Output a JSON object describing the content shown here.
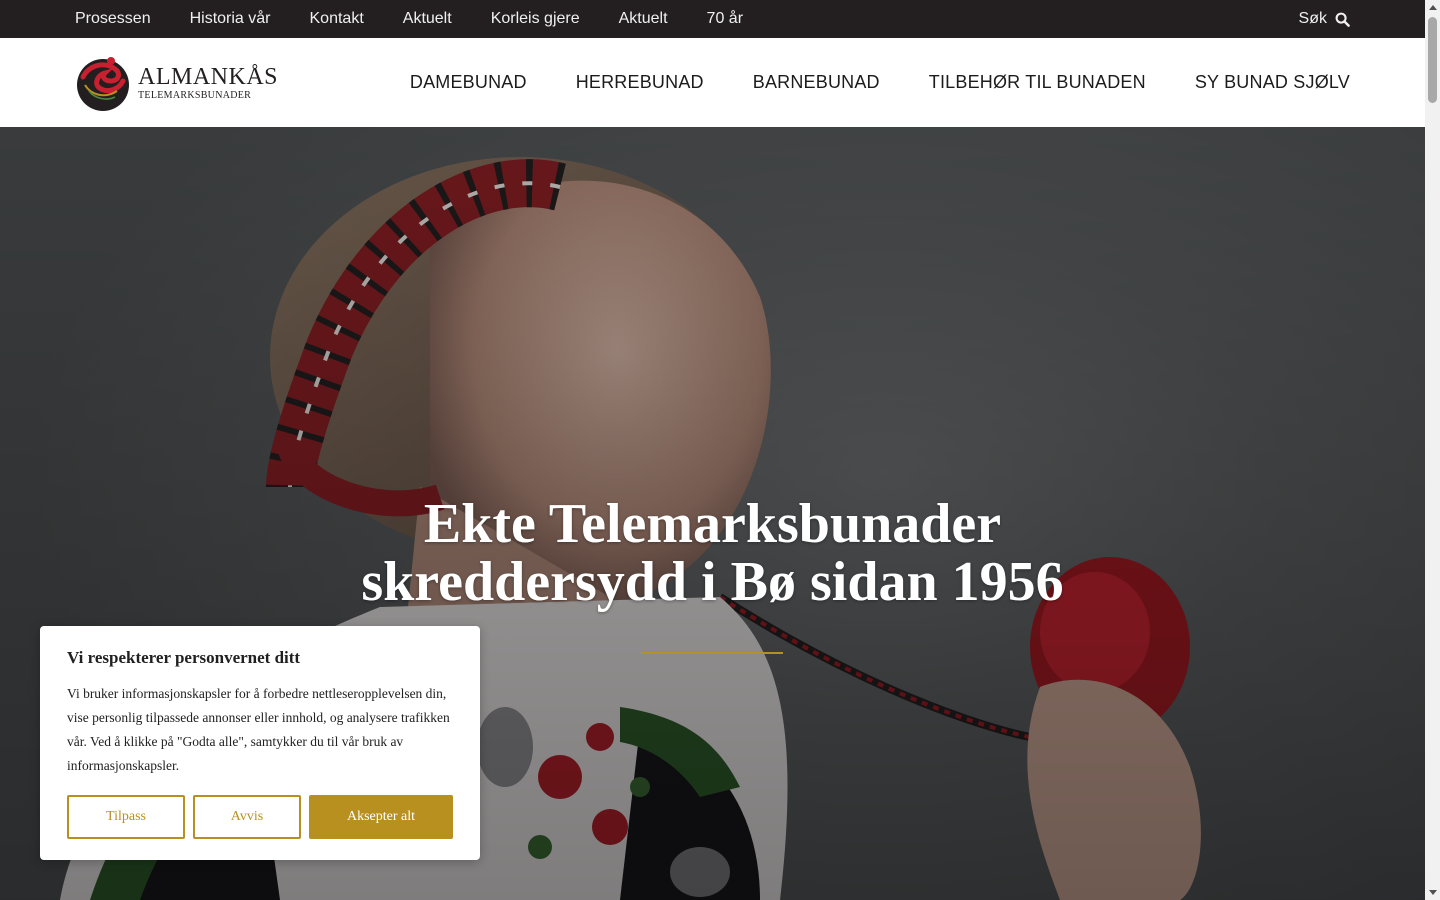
{
  "topbar": {
    "links": [
      "Prosessen",
      "Historia vår",
      "Kontakt",
      "Aktuelt",
      "Korleis gjere",
      "Aktuelt",
      "70 år"
    ],
    "search_label": "Søk"
  },
  "logo": {
    "name": "ALMANKÅS",
    "subtitle": "TELEMARKSBUNADER"
  },
  "mainnav": [
    "DAMEBUNAD",
    "HERREBUNAD",
    "BARNEBUNAD",
    "TILBEHØR TIL BUNADEN",
    "SY BUNAD SJØLV"
  ],
  "hero": {
    "title_line1": "Ekte Telemarksbunader",
    "title_line2": "skreddersydd i Bø sidan 1956"
  },
  "cookie": {
    "title": "Vi respekterer personvernet ditt",
    "body": "Vi bruker informasjonskapsler for å forbedre nettleseropplevelsen din, vise personlig tilpassede annonser eller innhold, og analysere trafikken vår. Ved å klikke på \"Godta alle\", samtykker du til vår bruk av informasjonskapsler.",
    "customize_label": "Tilpass",
    "reject_label": "Avvis",
    "accept_label": "Aksepter alt"
  },
  "colors": {
    "topbar_bg": "#231f20",
    "accent_gold": "#b8901f",
    "text_dark": "#1c1c1c"
  },
  "icons": {
    "search": "search-icon",
    "logo": "almankas-logo-icon"
  }
}
